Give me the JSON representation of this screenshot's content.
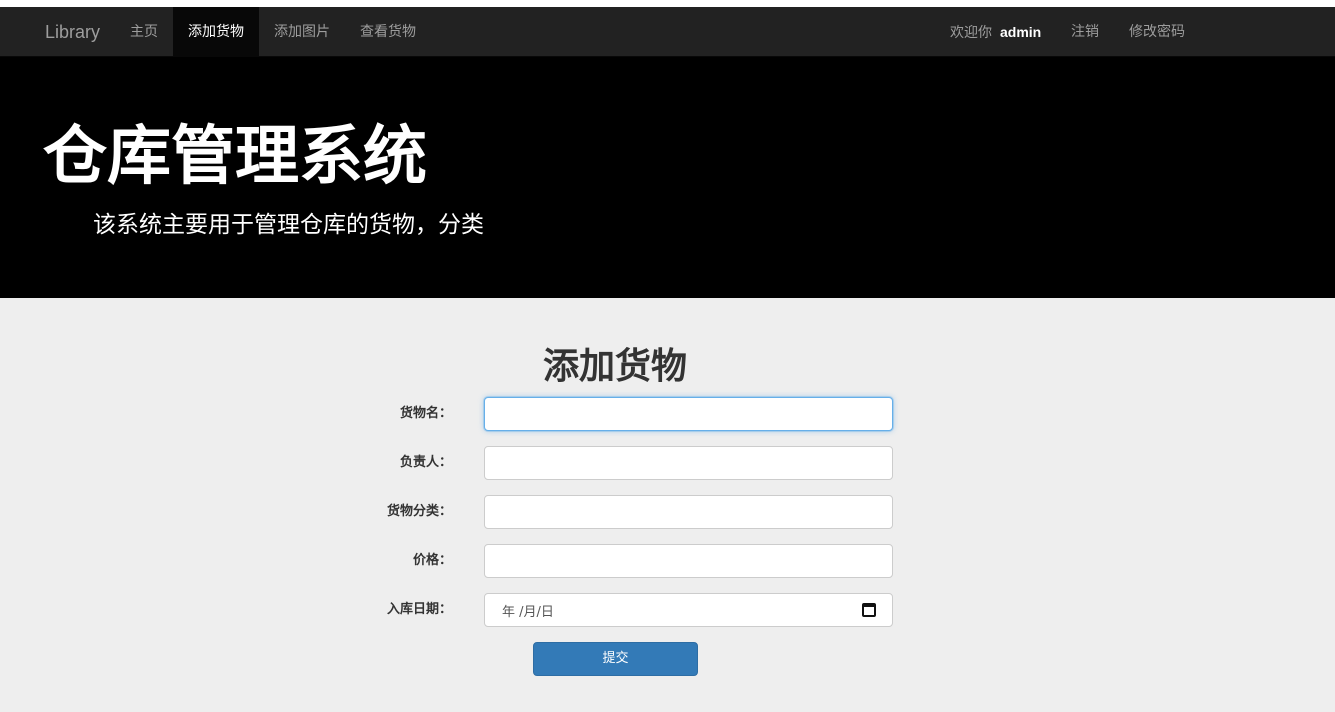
{
  "navbar": {
    "brand": "Library",
    "items": [
      {
        "label": "主页"
      },
      {
        "label": "添加货物",
        "active": true
      },
      {
        "label": "添加图片"
      },
      {
        "label": "查看货物"
      }
    ],
    "welcome_prefix": "欢迎你",
    "username": "admin",
    "logout_label": "注销",
    "change_password_label": "修改密码"
  },
  "jumbotron": {
    "title": "仓库管理系统",
    "subtitle": "该系统主要用于管理仓库的货物，分类"
  },
  "form": {
    "title": "添加货物",
    "fields": [
      {
        "label": "货物名：",
        "value": ""
      },
      {
        "label": "负责人：",
        "value": ""
      },
      {
        "label": "货物分类：",
        "value": ""
      },
      {
        "label": "价格：",
        "value": ""
      },
      {
        "label": "入库日期：",
        "placeholder": "年 /月/日"
      }
    ],
    "submit_label": "提交"
  },
  "colors": {
    "navbar_bg": "#222222",
    "jumbotron_bg": "#000000",
    "page_bg": "#eeeeee",
    "primary": "#337ab7",
    "focus_border": "#66afe9"
  }
}
